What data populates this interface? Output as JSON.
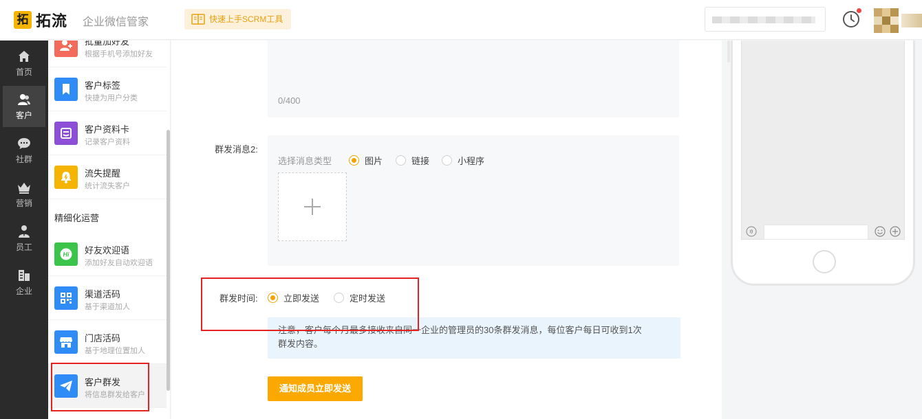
{
  "header": {
    "logo_mark": "拓",
    "logo_text": "拓流",
    "subtitle": "企业微信管家",
    "quick_start": "快速上手SCRM工具"
  },
  "leftnav": [
    {
      "label": "首页",
      "icon": "home-icon"
    },
    {
      "label": "客户",
      "icon": "customer-icon",
      "active": true
    },
    {
      "label": "社群",
      "icon": "chat-icon"
    },
    {
      "label": "营销",
      "icon": "crown-icon"
    },
    {
      "label": "员工",
      "icon": "staff-icon"
    },
    {
      "label": "企业",
      "icon": "building-icon"
    }
  ],
  "subnav": {
    "items": [
      {
        "title": "批量加好友",
        "desc": "根据手机号添加好友",
        "color": "#f26b5b"
      },
      {
        "title": "客户标签",
        "desc": "快捷为用户分类",
        "color": "#2f8cf6"
      },
      {
        "title": "客户资料卡",
        "desc": "记录客户资料",
        "color": "#8d4fd6"
      },
      {
        "title": "流失提醒",
        "desc": "统计流失客户",
        "color": "#f5b400"
      }
    ],
    "section": "精细化运营",
    "items2": [
      {
        "title": "好友欢迎语",
        "desc": "添加好友自动欢迎语",
        "color": "#3bc34a"
      },
      {
        "title": "渠道活码",
        "desc": "基于渠道加人",
        "color": "#2f8cf6"
      },
      {
        "title": "门店活码",
        "desc": "基于地理位置加人",
        "color": "#2f8cf6"
      },
      {
        "title": "客户群发",
        "desc": "将信息群发给客户",
        "color": "#2f8cf6",
        "active": true
      }
    ]
  },
  "form": {
    "counter": "0/400",
    "msg2_label": "群发消息2:",
    "type_label": "选择消息类型",
    "types": [
      "图片",
      "链接",
      "小程序"
    ],
    "selected_type": "图片",
    "time_label": "群发时间:",
    "time_options": [
      "立即发送",
      "定时发送"
    ],
    "selected_time": "立即发送",
    "notice_line1": "注意，客户每个月最多接收来自同一企业的管理员的30条群发消息，每位客户每日可收到1次",
    "notice_line2": "群发内容。",
    "send_button": "通知成员立即发送"
  },
  "colors": {
    "accent": "#f5a300",
    "nav_bg": "#2b2b2b",
    "annotation": "#e52222"
  }
}
